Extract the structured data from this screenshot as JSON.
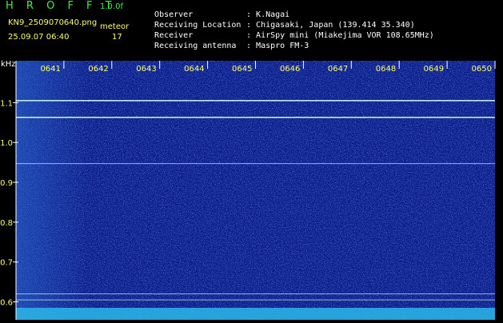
{
  "header": {
    "app_title": "H R O F F T",
    "version": "1.0.0f",
    "filename": "KN9_2509070640.png",
    "meteor_label": "meteor",
    "datetime": "25.09.07 06:40",
    "meteor_count": "17",
    "metadata": [
      {
        "key": "Observer",
        "value": "K.Nagai"
      },
      {
        "key": "Receiving Location",
        "value": "Chigasaki, Japan (139.414 35.340)"
      },
      {
        "key": "Receiver",
        "value": "AirSpy mini (Miakejima VOR 108.65MHz)"
      },
      {
        "key": "Receiving antenna",
        "value": "Maspro FM-3"
      }
    ]
  },
  "chart_data": {
    "type": "heatmap",
    "ylabel": "kHz",
    "x_ticks": [
      "0641",
      "0642",
      "0643",
      "0644",
      "0645",
      "0646",
      "0647",
      "0648",
      "0649",
      "0650"
    ],
    "y_ticks": [
      1.1,
      1.0,
      0.9,
      0.8,
      0.7,
      0.6
    ],
    "y_tick_labels": [
      "1.1",
      "1.0",
      "0.9",
      "0.8",
      "0.7",
      "0.6"
    ],
    "ylim": [
      0.555,
      1.205
    ],
    "xlim": [
      "0640",
      "0650"
    ],
    "horizontal_lines_khz": [
      1.105,
      1.063,
      0.947,
      0.62,
      0.605
    ],
    "colors": {
      "background": "#0a1a8a",
      "noise": "#3a7bd5",
      "signal": "#c8f0ff",
      "text": "#ffff66",
      "axis": "#ffffff"
    }
  }
}
